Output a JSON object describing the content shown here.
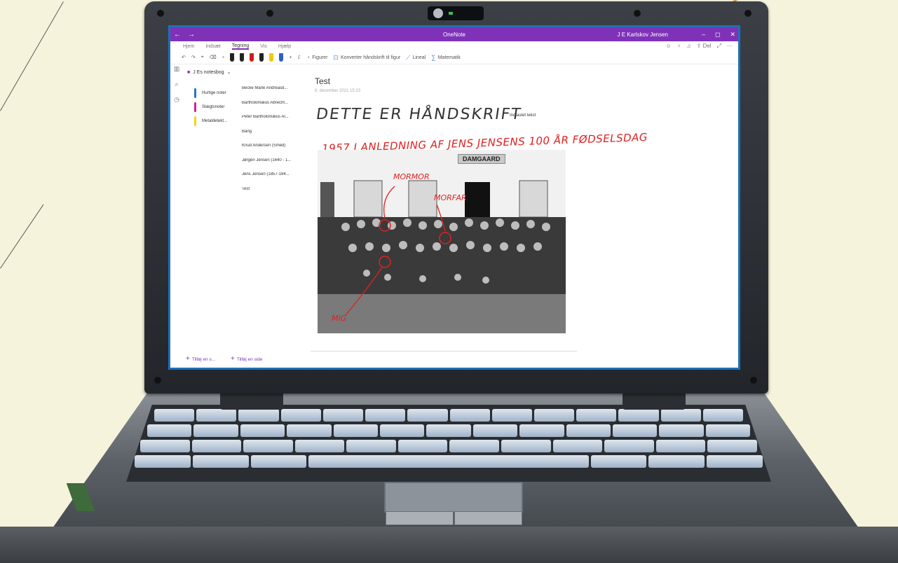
{
  "window": {
    "app_title": "OneNote",
    "user": "J E Karlskov Jensen",
    "back_icon": "back-arrow-icon",
    "forward_icon": "forward-arrow-icon",
    "controls": [
      "–",
      "◻",
      "✕"
    ]
  },
  "ribbon": {
    "tabs": [
      "Hjem",
      "Indsæt",
      "Tegning",
      "Vis",
      "Hjælp"
    ],
    "active_tab": "Tegning",
    "share_label": "Del",
    "tools": {
      "figures": "Figurer",
      "convert": "Konverter håndskrift til figur",
      "ruler": "Lineal",
      "math": "Matematik"
    },
    "pen_colors": [
      "#222222",
      "#222222",
      "#d11b1b",
      "#222222",
      "#f2c80f",
      "#2a60c8"
    ]
  },
  "sidebar": {
    "notebook_name": "J Es notesbog",
    "sections": [
      {
        "label": "Hurtige noter",
        "color": "#2a73c8"
      },
      {
        "label": "Slægtsnoter",
        "color": "#d0238c"
      },
      {
        "label": "Metaldetekt...",
        "color": "#f2d21b"
      }
    ],
    "pages": [
      "Becke Marie Andreasd...",
      "Bartholomæus Abrecht...",
      "Peter Bartholomæus Al...",
      "Bang",
      "Knud Andersen (Smed)",
      "Jørgen Jensen (1640 - 1...",
      "Jens Jensen (1857-194...",
      "Test"
    ],
    "add_section": "Tilføj en s...",
    "add_page": "Tilføj en side"
  },
  "page": {
    "title": "Test",
    "date": "6. december 2021     15:23",
    "handwriting_title": "DETTE ER HÅNDSKRIFT",
    "typed_text": "Indtastet tekst",
    "red_annotation": "1957 I ANLEDNING AF JENS JENSENS 100 ÅR FØDSELSDAG",
    "photo": {
      "sign_text": "DAMGAARD",
      "labels": [
        "MORMOR",
        "MORFAR",
        "MIG"
      ]
    }
  }
}
